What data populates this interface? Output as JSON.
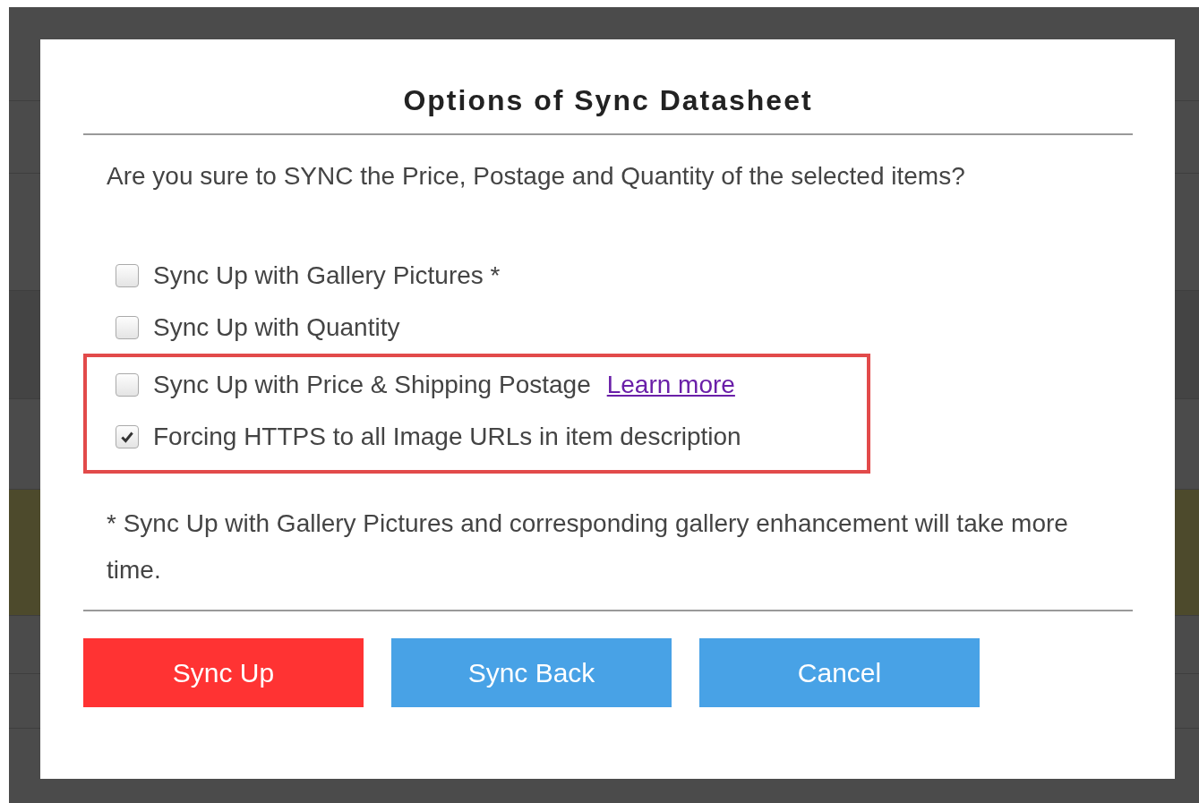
{
  "dialog": {
    "title": "Options of Sync Datasheet",
    "question": "Are you sure to SYNC the Price, Postage and Quantity of the selected items?",
    "options": [
      {
        "label": "Sync Up with Gallery Pictures *",
        "checked": false,
        "highlighted": false
      },
      {
        "label": "Sync Up with Quantity",
        "checked": false,
        "highlighted": false
      },
      {
        "label": "Sync Up with Price & Shipping Postage",
        "checked": false,
        "highlighted": true,
        "link": "Learn more"
      },
      {
        "label": "Forcing HTTPS to all Image URLs in item description",
        "checked": true,
        "highlighted": true
      }
    ],
    "note": "* Sync Up with Gallery Pictures and corresponding gallery enhancement will take more time.",
    "buttons": [
      {
        "label": "Sync Up",
        "kind": "danger"
      },
      {
        "label": "Sync Back",
        "kind": "primary"
      },
      {
        "label": "Cancel",
        "kind": "primary"
      }
    ]
  }
}
